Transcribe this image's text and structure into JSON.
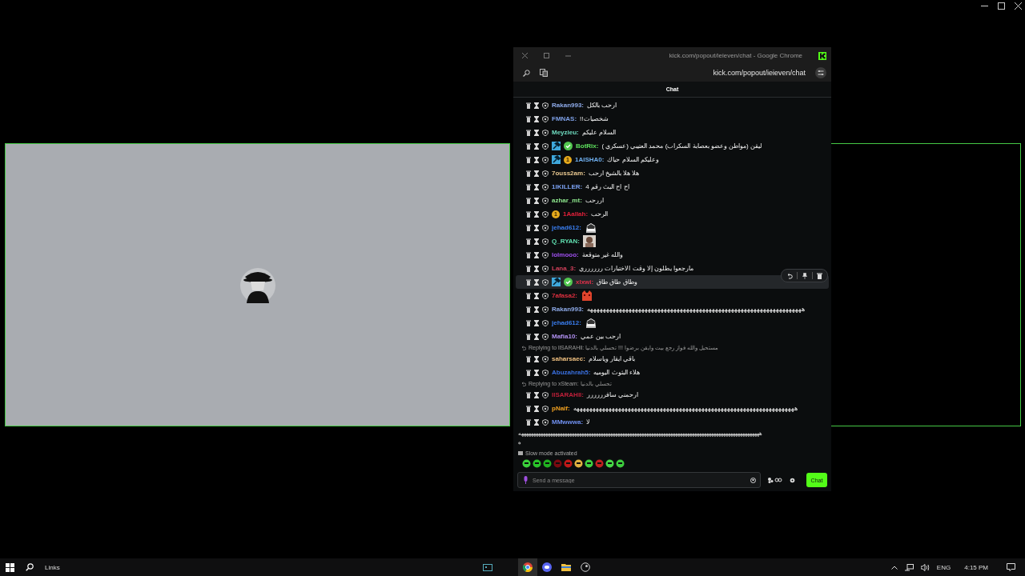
{
  "window": {
    "title": "kick.com/popout/ieieven/chat - Google Chrome",
    "address": "kick.com/popout/ieieven/chat"
  },
  "chat": {
    "header": "Chat",
    "messages": [
      {
        "kind": "text",
        "name": "Rakan993:",
        "color": "#8eaae8",
        "text": "ارحب بالكل",
        "hovered": false
      },
      {
        "kind": "text",
        "name": "FMNAS:",
        "color": "#7ea0e6",
        "text": "شخصيات!!",
        "hovered": false
      },
      {
        "kind": "text",
        "name": "Meyzieu:",
        "color": "#6fdcc0",
        "text": "السلام عليكم",
        "hovered": false
      },
      {
        "kind": "text",
        "name": "BotRix:",
        "color": "#5ee05e",
        "badges": [
          {
            "kind": "mod"
          },
          {
            "kind": "verified"
          }
        ],
        "text": "ليقن (مواطن وعضو بعصابة السكراب) محمد العتيبي (عسكري )",
        "hovered": false
      },
      {
        "kind": "text",
        "name": "1AISHA0:",
        "color": "#70b0f0",
        "badges": [
          {
            "kind": "mod"
          },
          {
            "kind": "sub",
            "label": "1"
          }
        ],
        "text": "وعليكم السلام حياك",
        "hovered": false
      },
      {
        "kind": "text",
        "name": "7ouss2am:",
        "color": "#e8c890",
        "text": "هلا هلا بالشيخ ارحب",
        "hovered": false
      },
      {
        "kind": "text",
        "name": "1lKILLER:",
        "color": "#7aa0f0",
        "text": "اح اح البث رقم 4",
        "hovered": false
      },
      {
        "kind": "text",
        "name": "azhar_mt:",
        "color": "#8ee88e",
        "text": "اررحب",
        "hovered": false
      },
      {
        "kind": "text",
        "name": "1Aallah:",
        "color": "#e0203a",
        "badges": [
          {
            "kind": "sub",
            "label": "1"
          }
        ],
        "text": "الرحب",
        "hovered": false
      },
      {
        "kind": "emote",
        "name": "jehad612:",
        "color": "#3a7ef0",
        "hovered": false
      },
      {
        "kind": "emote",
        "name": "Q_RYAN:",
        "color": "#60e0b0",
        "hovered": false
      },
      {
        "kind": "text",
        "name": "lolmooo:",
        "color": "#a050f0",
        "text": "والله غير متوقعة",
        "hovered": false
      },
      {
        "kind": "text",
        "name": "Lana_3:",
        "color": "#d0405a",
        "text": "مارجعوا يطلون إلا وقت الاختبارات رررررري",
        "hovered": false
      },
      {
        "kind": "text",
        "name": "xlxwi:",
        "color": "#e0304a",
        "badges": [
          {
            "kind": "mod"
          },
          {
            "kind": "verified"
          }
        ],
        "text": "وطاق طاق طاق",
        "hovered": true
      },
      {
        "kind": "emote",
        "name": "7afasa2:",
        "color": "#e03040",
        "hovered": false
      },
      {
        "kind": "text",
        "name": "Rakan993:",
        "color": "#8eaae8",
        "text": "هههههههههههههههههههههههههههههههههههههههههههههههههههههههههههههههههههه",
        "hovered": false
      },
      {
        "kind": "emote",
        "name": "jehad612:",
        "color": "#3a7ef0",
        "hovered": false
      },
      {
        "kind": "text",
        "name": "Mafia10:",
        "color": "#b090f0",
        "text": "ارحب بين عمي",
        "hovered": false
      },
      {
        "kind": "text",
        "name": "saharsaec:",
        "color": "#f0c080",
        "text": "باقي ايقار وياسلام",
        "reply_to": "Replying to llSARAHll: مستحيل والله فواز رجع بيت وايقن برضوا !!! تحسلي بالدنيا",
        "hovered": false
      },
      {
        "kind": "text",
        "name": "Abuzahrah5:",
        "color": "#3a70e0",
        "text": "هلاء البثوث اليوميه",
        "hovered": false
      },
      {
        "kind": "text",
        "name": "llSARAHll:",
        "color": "#c0203a",
        "text": "ارحمني سافرررررر",
        "reply_to": "Replying to xSteam: تحسلي بالدنيا",
        "hovered": false
      },
      {
        "kind": "text",
        "name": "pNaif:",
        "color": "#f0a020",
        "text": "هههههههههههههههههههههههههههههههههههههههههههههههههههههههههههههههههههههه",
        "hovered": false
      },
      {
        "kind": "text",
        "name": "MMwwwa:",
        "color": "#7090f0",
        "text": "لا",
        "continued": [
          "ههههههههههههههههههههههههههههههههههههههههههههههههههههههههههههههههههههههههههههههههههههههههههههههههههههه",
          "ه"
        ],
        "hovered": false
      }
    ],
    "slow_mode": "Slow mode activated",
    "input": {
      "placeholder": "Send a message"
    },
    "send_button": "Chat"
  },
  "taskbar": {
    "search": "Links",
    "language": "ENG",
    "time": "4:15 PM"
  }
}
